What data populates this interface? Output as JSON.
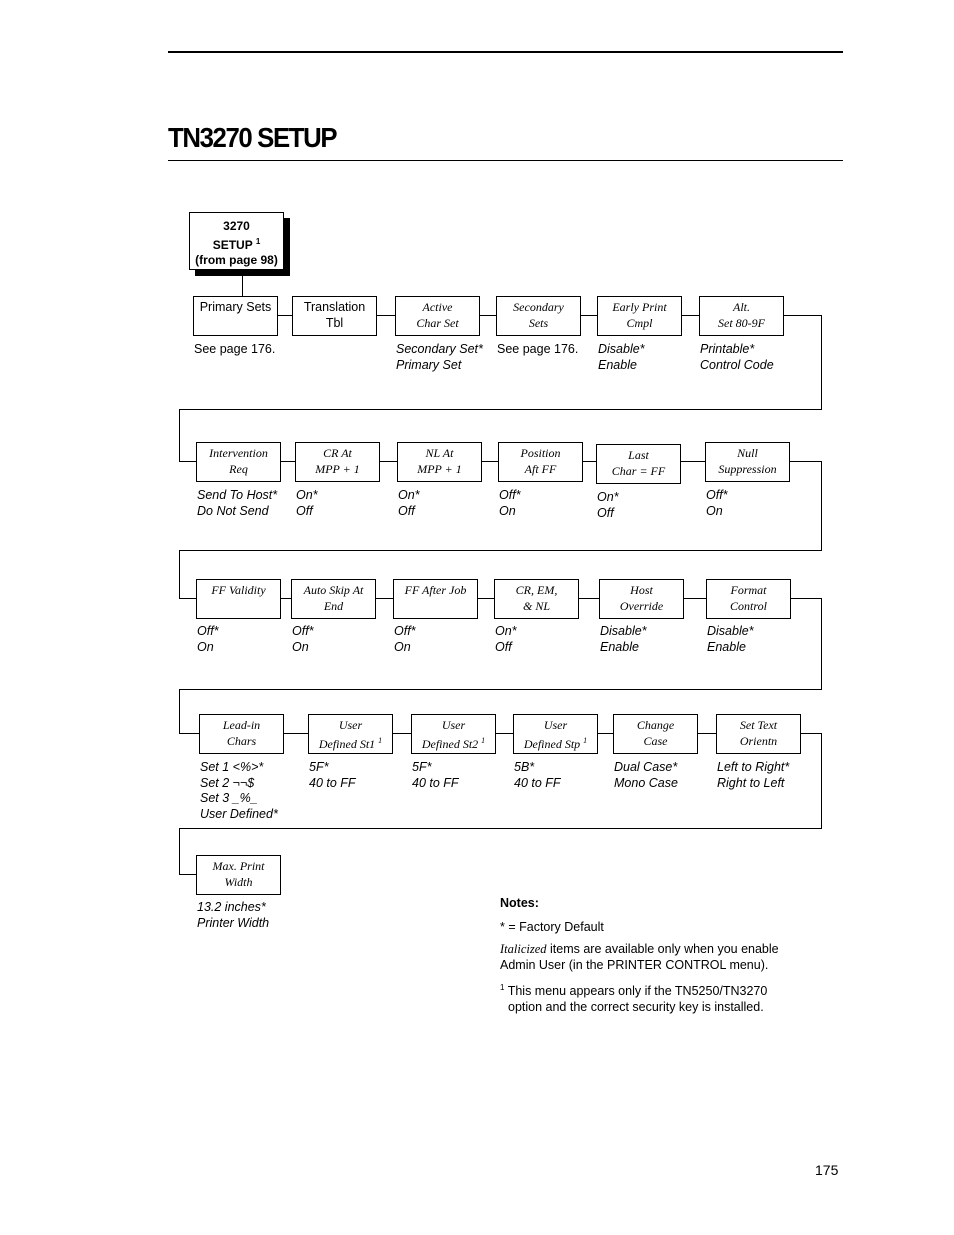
{
  "page": {
    "title": "TN3270 SETUP",
    "page_number": "175"
  },
  "root": {
    "line1": "3270",
    "line2": "SETUP",
    "sup": "1",
    "line3": "(from page 98)"
  },
  "rows": [
    [
      {
        "l1": "Primary Sets",
        "l2": "",
        "sup": "",
        "italic": false,
        "options": [
          "See page 176."
        ],
        "options_italic": false
      },
      {
        "l1": "Translation",
        "l2": "Tbl",
        "sup": "",
        "italic": false,
        "options": [],
        "options_italic": false
      },
      {
        "l1": "Active",
        "l2": "Char Set",
        "sup": "",
        "italic": true,
        "options": [
          "Secondary Set*",
          "Primary Set"
        ],
        "options_italic": true
      },
      {
        "l1": "Secondary",
        "l2": "Sets",
        "sup": "",
        "italic": true,
        "options": [
          "See page 176."
        ],
        "options_italic": false
      },
      {
        "l1": "Early Print",
        "l2": "Cmpl",
        "sup": "",
        "italic": true,
        "options": [
          "Disable*",
          "Enable"
        ],
        "options_italic": true
      },
      {
        "l1": "Alt.",
        "l2": "Set 80-9F",
        "sup": "",
        "italic": true,
        "options": [
          "Printable*",
          "Control Code"
        ],
        "options_italic": true
      }
    ],
    [
      {
        "l1": "Intervention",
        "l2": "Req",
        "sup": "",
        "italic": true,
        "options": [
          "Send To Host*",
          "Do Not Send"
        ],
        "options_italic": true
      },
      {
        "l1": "CR At",
        "l2": "MPP + 1",
        "sup": "",
        "italic": true,
        "options": [
          "On*",
          "Off"
        ],
        "options_italic": true
      },
      {
        "l1": "NL At",
        "l2": "MPP + 1",
        "sup": "",
        "italic": true,
        "options": [
          "On*",
          "Off"
        ],
        "options_italic": true
      },
      {
        "l1": "Position",
        "l2": "Aft FF",
        "sup": "",
        "italic": true,
        "options": [
          "Off*",
          "On"
        ],
        "options_italic": true
      },
      {
        "l1": "Last",
        "l2": "Char = FF",
        "sup": "",
        "italic": true,
        "options": [
          "On*",
          "Off"
        ],
        "options_italic": true
      },
      {
        "l1": "Null",
        "l2": "Suppression",
        "sup": "",
        "italic": true,
        "options": [
          "Off*",
          "On"
        ],
        "options_italic": true
      }
    ],
    [
      {
        "l1": "FF Validity",
        "l2": "",
        "sup": "",
        "italic": true,
        "options": [
          "Off*",
          "On"
        ],
        "options_italic": true
      },
      {
        "l1": "Auto Skip At",
        "l2": "End",
        "sup": "",
        "italic": true,
        "options": [
          "Off*",
          "On"
        ],
        "options_italic": true
      },
      {
        "l1": "FF After Job",
        "l2": "",
        "sup": "",
        "italic": true,
        "options": [
          "Off*",
          "On"
        ],
        "options_italic": true
      },
      {
        "l1": "CR, EM,",
        "l2": "& NL",
        "sup": "",
        "italic": true,
        "options": [
          "On*",
          "Off"
        ],
        "options_italic": true
      },
      {
        "l1": "Host",
        "l2": "Override",
        "sup": "",
        "italic": true,
        "options": [
          "Disable*",
          "Enable"
        ],
        "options_italic": true
      },
      {
        "l1": "Format",
        "l2": "Control",
        "sup": "",
        "italic": true,
        "options": [
          "Disable*",
          "Enable"
        ],
        "options_italic": true
      }
    ],
    [
      {
        "l1": "Lead-in",
        "l2": "Chars",
        "sup": "",
        "italic": true,
        "options": [
          "Set 1 <%>*",
          "Set 2 ¬¬$",
          "Set 3 _%_",
          "User Defined*"
        ],
        "options_italic": true
      },
      {
        "l1": "User",
        "l2": "Defined St1",
        "sup": "1",
        "italic": true,
        "options": [
          "5F*",
          "40 to FF"
        ],
        "options_italic": true
      },
      {
        "l1": "User",
        "l2": "Defined St2",
        "sup": "1",
        "italic": true,
        "options": [
          "5F*",
          "40 to FF"
        ],
        "options_italic": true
      },
      {
        "l1": "User",
        "l2": "Defined Stp",
        "sup": "1",
        "italic": true,
        "options": [
          "5B*",
          "40 to FF"
        ],
        "options_italic": true
      },
      {
        "l1": "Change",
        "l2": "Case",
        "sup": "",
        "italic": true,
        "options": [
          "Dual Case*",
          "Mono Case"
        ],
        "options_italic": true
      },
      {
        "l1": "Set Text",
        "l2": "Orientn",
        "sup": "",
        "italic": true,
        "options": [
          "Left to Right*",
          "Right to Left"
        ],
        "options_italic": true
      }
    ],
    [
      {
        "l1": "Max. Print",
        "l2": "Width",
        "sup": "",
        "italic": true,
        "options": [
          "13.2 inches*",
          "Printer Width"
        ],
        "options_italic": true
      }
    ]
  ],
  "notes": {
    "heading": "Notes:",
    "default": "* = Factory Default",
    "italic_word": "Italicized",
    "italic_rest": " items are available only when you enable Admin User (in the PRINTER CONTROL menu).",
    "footnote_mark": "1",
    "footnote_text": " This menu appears only if the TN5250/TN3270 option and the correct security key is installed."
  }
}
